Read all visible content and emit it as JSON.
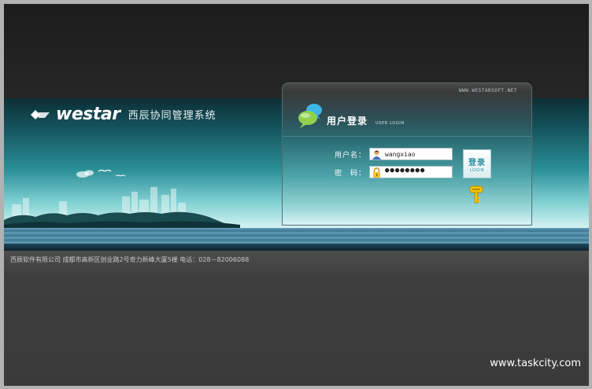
{
  "logo": {
    "wordmark": "westar",
    "system_title": "西辰协同管理系统"
  },
  "login_panel": {
    "site_url": "WWW.WESTARSOFT.NET",
    "title": "用户登录",
    "subtitle": "USER LOGIN",
    "username_label": "用户名：",
    "username_value": "wangxiao",
    "password_label": "密　码：",
    "password_value": "●●●●●●●●",
    "login_button_label": "登录",
    "login_button_sub": "LOGIN"
  },
  "footer": {
    "text": "西辰软件有限公司   成都市高新区创业路2号奇力新峰大厦5楼   电话：028－82006088"
  },
  "watermark": "www.taskcity.com",
  "colors": {
    "frame": "#b2b2b2",
    "banner_top": "#14525c",
    "banner_bottom": "#d4f3f1",
    "button_text": "#2b8ea0"
  },
  "icons": {
    "logo": "westar-logo-icon",
    "panel": "chat-bubble-icon",
    "user": "user-avatar-icon",
    "password": "padlock-icon",
    "help": "key-icon"
  }
}
